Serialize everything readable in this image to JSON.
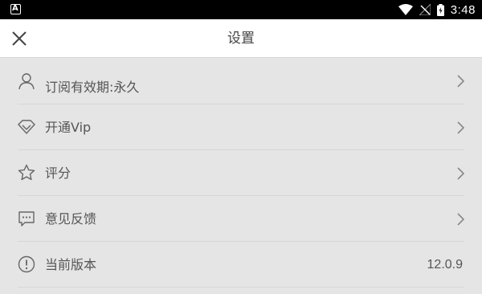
{
  "status_bar": {
    "time": "3:48",
    "notification_icon": "a-notification-icon",
    "wifi_icon": "wifi-icon",
    "signal_icon": "no-signal-icon",
    "battery_icon": "battery-charging-icon"
  },
  "header": {
    "title": "设置",
    "close_icon": "close-icon"
  },
  "settings": {
    "items": [
      {
        "label": "订阅有效期:永久",
        "icon": "user-icon",
        "action": "chevron"
      },
      {
        "label": "开通Vip",
        "icon": "diamond-icon",
        "action": "chevron"
      },
      {
        "label": "评分",
        "icon": "star-icon",
        "action": "chevron"
      },
      {
        "label": "意见反馈",
        "icon": "feedback-icon",
        "action": "chevron"
      },
      {
        "label": "当前版本",
        "icon": "info-icon",
        "value": "12.0.9"
      }
    ]
  },
  "colors": {
    "background": "#e5e5e5",
    "app_bar": "#ffffff",
    "status_bar": "#000000",
    "text": "#555555",
    "divider": "#d6d6d6"
  }
}
